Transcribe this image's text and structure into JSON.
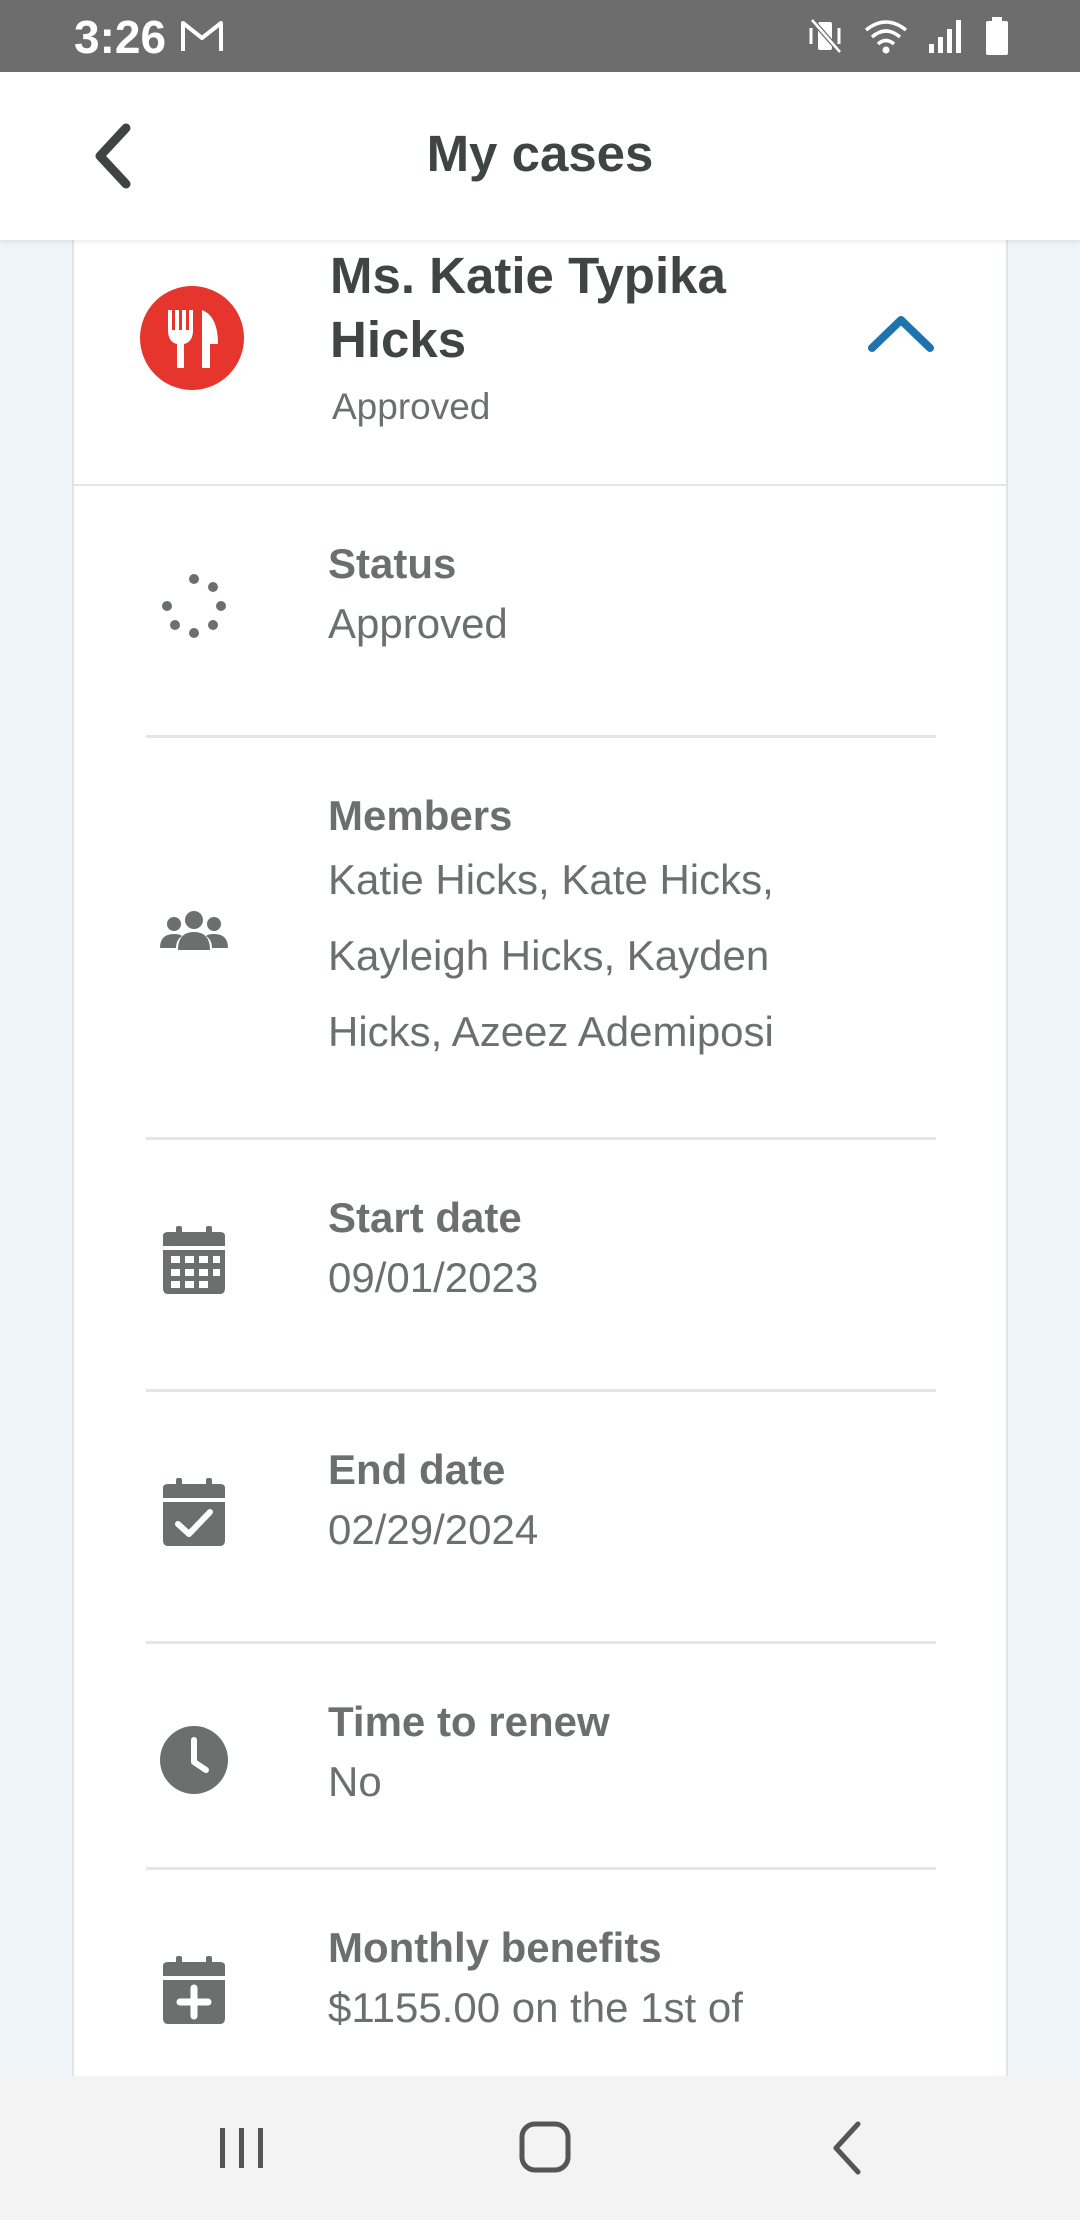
{
  "status_bar": {
    "time": "3:26",
    "icons": [
      "gmail-icon",
      "vibrate-off-icon",
      "wifi-icon",
      "signal-icon",
      "battery-icon"
    ]
  },
  "app_bar": {
    "title": "My cases",
    "back_icon": "chevron-left-icon"
  },
  "case": {
    "name": "Ms. Katie Typika Hicks",
    "status": "Approved",
    "icon": "fork-knife-icon",
    "icon_color": "#e5352c",
    "toggle_icon": "chevron-up-icon",
    "accent_color": "#1f74ad"
  },
  "details": [
    {
      "label": "Status",
      "value": "Approved",
      "icon": "spinner-dots-icon"
    },
    {
      "label": "Members",
      "value": "Katie Hicks, Kate Hicks, Kayleigh Hicks, Kayden Hicks, Azeez Ademiposi",
      "icon": "group-icon"
    },
    {
      "label": "Start date",
      "value": "09/01/2023",
      "icon": "calendar-icon"
    },
    {
      "label": "End date",
      "value": "02/29/2024",
      "icon": "calendar-check-icon"
    },
    {
      "label": "Time to renew",
      "value": "No",
      "icon": "clock-icon"
    },
    {
      "label": "Monthly benefits",
      "value": "$1155.00 on the 1st of",
      "icon": "calendar-plus-icon"
    }
  ],
  "nav_bar": {
    "icons": [
      "recent-apps-icon",
      "home-icon",
      "back-icon"
    ]
  }
}
